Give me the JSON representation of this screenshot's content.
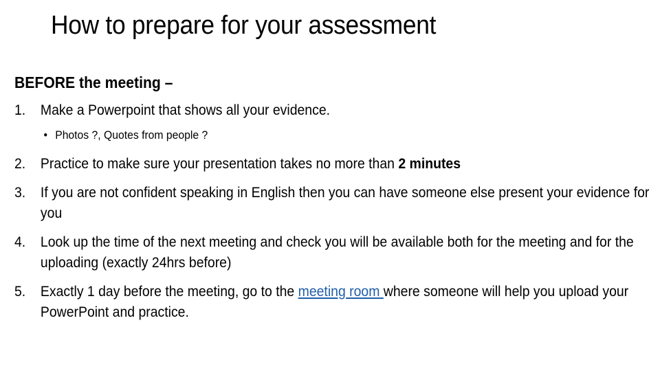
{
  "slide": {
    "title": "How to prepare for your assessment",
    "heading": "BEFORE the meeting –",
    "items": [
      {
        "number": "1.",
        "text": "Make a Powerpoint that shows all your evidence.",
        "subitems": [
          {
            "bullet": "•",
            "text": "Photos ?, Quotes from people ?"
          }
        ]
      },
      {
        "number": "2.",
        "text_before": "Practice to make sure your presentation takes no more than ",
        "bold": "2 minutes"
      },
      {
        "number": "3.",
        "text": "If you are not confident speaking in English then you can have someone else present your evidence for you"
      },
      {
        "number": "4.",
        "text": "Look up the time of the next meeting and check you will be available both for the meeting and for the uploading (exactly 24hrs before)"
      },
      {
        "number": "5.",
        "text_before": "Exactly 1 day before the meeting, go to the ",
        "link": "meeting room ",
        "text_after": " where someone will help you upload your PowerPoint and practice."
      }
    ],
    "colors": {
      "text": "#000000",
      "link": "#1f5fa8",
      "background": "#ffffff"
    }
  }
}
